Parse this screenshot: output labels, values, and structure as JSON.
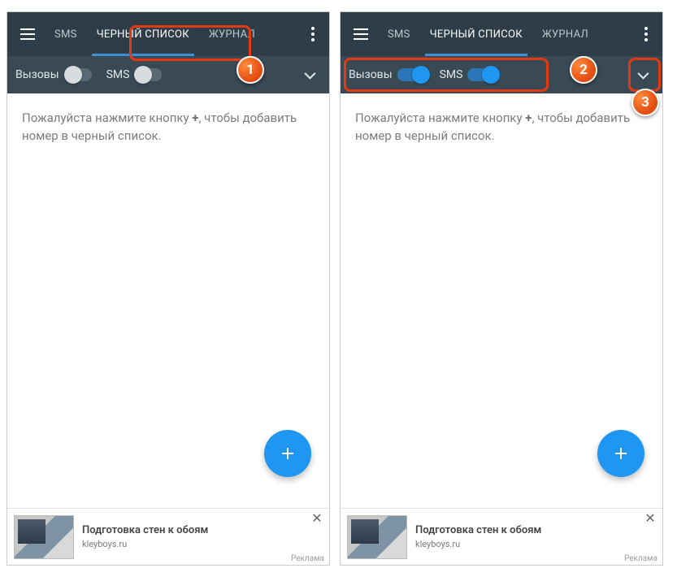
{
  "tabs": {
    "sms": "SMS",
    "blacklist": "ЧЕРНЫЙ СПИСОК",
    "journal": "ЖУРНАЛ"
  },
  "filters": {
    "calls": "Вызовы",
    "sms": "SMS"
  },
  "hint_pre": "Пожалуйста нажмите кнопку ",
  "hint_plus": "+",
  "hint_post": ", чтобы добавить номер в черный список.",
  "ad": {
    "title": "Подготовка стен к обоям",
    "source": "kleyboys.ru",
    "tag": "Реклама"
  },
  "callouts": {
    "c1": "1",
    "c2": "2",
    "c3": "3"
  }
}
